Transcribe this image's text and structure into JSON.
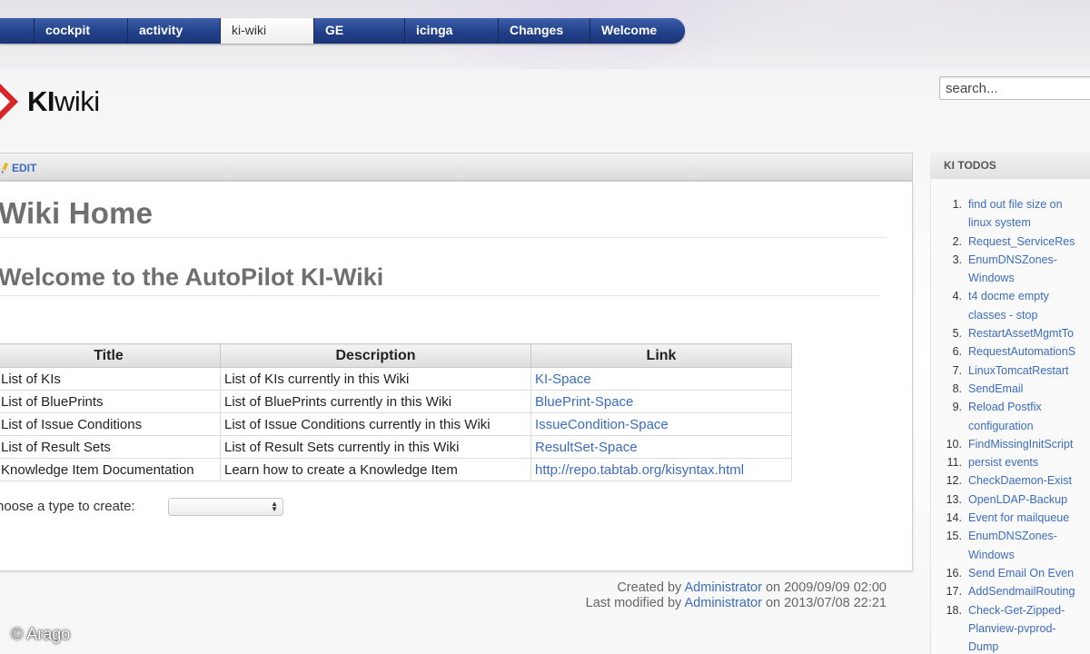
{
  "nav": {
    "tabs": [
      {
        "label": "cockpit"
      },
      {
        "label": "activity"
      },
      {
        "label": "ki-wiki",
        "active": true
      },
      {
        "label": "GE"
      },
      {
        "label": "icinga"
      },
      {
        "label": "Changes"
      },
      {
        "label": "Welcome"
      }
    ]
  },
  "logo": {
    "bold": "KI",
    "rest": "wiki"
  },
  "search": {
    "placeholder": "search..."
  },
  "edit_label": "EDIT",
  "page": {
    "title": "Wiki Home",
    "heading": "Welcome to the AutoPilot KI-Wiki"
  },
  "table": {
    "headers": [
      "Title",
      "Description",
      "Link"
    ],
    "rows": [
      {
        "title": "List of KIs",
        "description": "List of KIs currently in this Wiki",
        "link": "KI-Space"
      },
      {
        "title": "List of BluePrints",
        "description": "List of BluePrints currently in this Wiki",
        "link": "BluePrint-Space"
      },
      {
        "title": "List of Issue Conditions",
        "description": "List of Issue Conditions currently in this Wiki",
        "link": "IssueCondition-Space"
      },
      {
        "title": "List of Result Sets",
        "description": "List of Result Sets currently in this Wiki",
        "link": "ResultSet-Space"
      },
      {
        "title": "Knowledge Item Documentation",
        "description": "Learn how to create a Knowledge Item",
        "link": "http://repo.tabtab.org/kisyntax.html"
      }
    ]
  },
  "create": {
    "label": "hoose a type to create:",
    "selected": ""
  },
  "meta": {
    "created_prefix": "Created by",
    "created_user": "Administrator",
    "created_suffix": "on 2009/09/09 02:00",
    "modified_prefix": "Last modified by",
    "modified_user": "Administrator",
    "modified_suffix": "on 2013/07/08 22:21"
  },
  "sidebar": {
    "title": "KI TODOS",
    "todos": [
      {
        "num": "1.",
        "text": "find out file size on linux system",
        "wrap": true
      },
      {
        "num": "2.",
        "text": "Request_ServiceRes"
      },
      {
        "num": "3.",
        "text": "EnumDNSZones-Windows",
        "wrap": true
      },
      {
        "num": "4.",
        "text": "t4 docme empty classes - stop",
        "wrap": true
      },
      {
        "num": "5.",
        "text": "RestartAssetMgmtTo"
      },
      {
        "num": "6.",
        "text": "RequestAutomationS"
      },
      {
        "num": "7.",
        "text": "LinuxTomcatRestart"
      },
      {
        "num": "8.",
        "text": "SendEmail"
      },
      {
        "num": "9.",
        "text": "Reload Postfix configuration",
        "wrap": true
      },
      {
        "num": "10.",
        "text": "FindMissingInitScript"
      },
      {
        "num": "11.",
        "text": "persist events"
      },
      {
        "num": "12.",
        "text": "CheckDaemon-Exist"
      },
      {
        "num": "13.",
        "text": "OpenLDAP-Backup"
      },
      {
        "num": "14.",
        "text": "Event for mailqueue"
      },
      {
        "num": "15.",
        "text": "EnumDNSZones-Windows",
        "wrap": true
      },
      {
        "num": "16.",
        "text": "Send Email On Even"
      },
      {
        "num": "17.",
        "text": "AddSendmailRouting"
      },
      {
        "num": "18.",
        "text": "Check-Get-Zipped-Planview-pvprod-Dump",
        "wrap": true
      }
    ]
  },
  "copyright": "© Arago",
  "colors": {
    "nav_blue": "#26468f",
    "link_blue": "#3b6cc0",
    "heading_gray": "#6f6f6f",
    "logo_red": "#d8262b"
  }
}
